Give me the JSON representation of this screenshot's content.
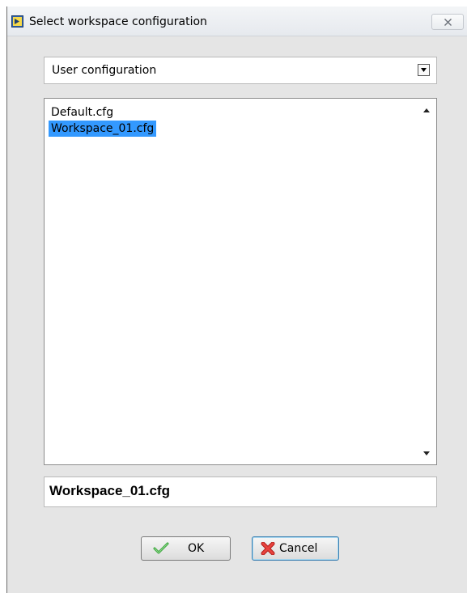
{
  "window": {
    "title": "Select workspace configuration"
  },
  "dropdown": {
    "selected": "User configuration"
  },
  "file_list": {
    "items": [
      {
        "label": "Default.cfg",
        "selected": false
      },
      {
        "label": "Workspace_01.cfg",
        "selected": true
      }
    ]
  },
  "filename_field": {
    "value": "Workspace_01.cfg"
  },
  "buttons": {
    "ok_label": "OK",
    "cancel_label": "Cancel"
  },
  "icons": {
    "app": "labview-app-icon",
    "close": "close-icon",
    "dropdown": "chevron-down-icon",
    "ok": "checkmark-icon",
    "cancel": "red-x-icon"
  },
  "colors": {
    "selection": "#3399ff",
    "window_bg": "#e5e5e5",
    "ok_check": "#3aa53a",
    "cancel_x": "#d9302c"
  }
}
